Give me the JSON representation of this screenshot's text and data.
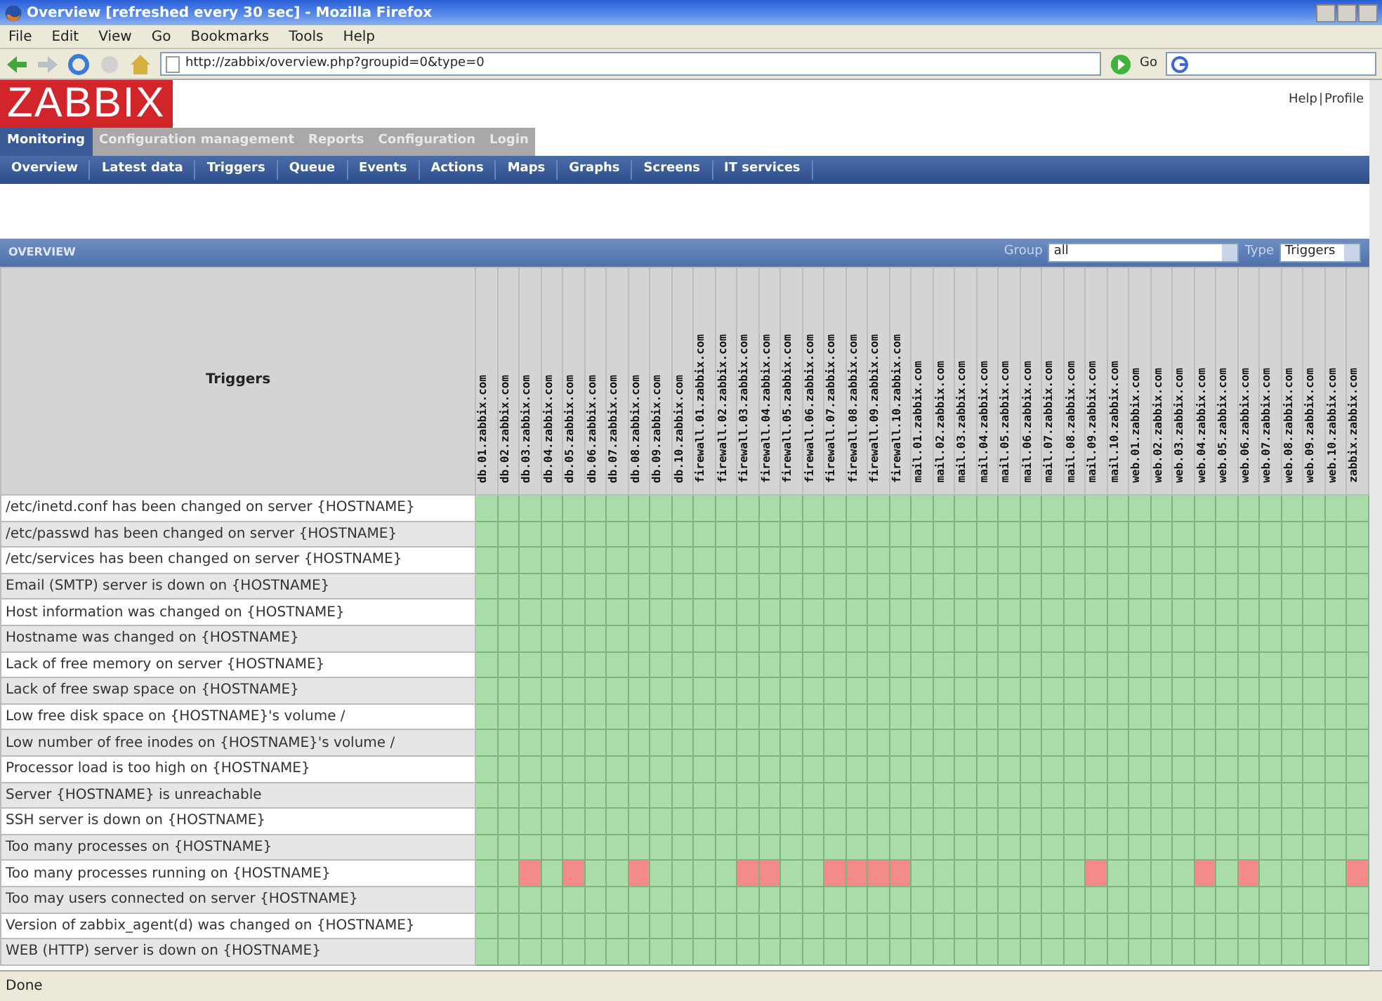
{
  "window": {
    "title": "Overview [refreshed every 30 sec] - Mozilla Firefox"
  },
  "browser_menu": [
    "File",
    "Edit",
    "View",
    "Go",
    "Bookmarks",
    "Tools",
    "Help"
  ],
  "address_bar": {
    "url": "http://zabbix/overview.php?groupid=0&type=0",
    "go_label": "Go"
  },
  "header": {
    "logo": "ZABBIX",
    "links": [
      "Help",
      "|",
      "Profile"
    ]
  },
  "main_menu": [
    {
      "label": "Monitoring",
      "selected": true
    },
    {
      "label": "Configuration management",
      "selected": false
    },
    {
      "label": "Reports",
      "selected": false
    },
    {
      "label": "Configuration",
      "selected": false
    },
    {
      "label": "Login",
      "selected": false
    }
  ],
  "sub_menu": [
    "Overview",
    "Latest data",
    "Triggers",
    "Queue",
    "Events",
    "Actions",
    "Maps",
    "Graphs",
    "Screens",
    "IT services"
  ],
  "overview": {
    "title": "OVERVIEW",
    "group_label": "Group",
    "group_value": "all",
    "type_label": "Type",
    "type_value": "Triggers"
  },
  "table": {
    "first_column": "Triggers",
    "hosts": [
      "db.01.zabbix.com",
      "db.02.zabbix.com",
      "db.03.zabbix.com",
      "db.04.zabbix.com",
      "db.05.zabbix.com",
      "db.06.zabbix.com",
      "db.07.zabbix.com",
      "db.08.zabbix.com",
      "db.09.zabbix.com",
      "db.10.zabbix.com",
      "firewall.01.zabbix.com",
      "firewall.02.zabbix.com",
      "firewall.03.zabbix.com",
      "firewall.04.zabbix.com",
      "firewall.05.zabbix.com",
      "firewall.06.zabbix.com",
      "firewall.07.zabbix.com",
      "firewall.08.zabbix.com",
      "firewall.09.zabbix.com",
      "firewall.10.zabbix.com",
      "mail.01.zabbix.com",
      "mail.02.zabbix.com",
      "mail.03.zabbix.com",
      "mail.04.zabbix.com",
      "mail.05.zabbix.com",
      "mail.06.zabbix.com",
      "mail.07.zabbix.com",
      "mail.08.zabbix.com",
      "mail.09.zabbix.com",
      "mail.10.zabbix.com",
      "web.01.zabbix.com",
      "web.02.zabbix.com",
      "web.03.zabbix.com",
      "web.04.zabbix.com",
      "web.05.zabbix.com",
      "web.06.zabbix.com",
      "web.07.zabbix.com",
      "web.08.zabbix.com",
      "web.09.zabbix.com",
      "web.10.zabbix.com",
      "zabbix.zabbix.com"
    ],
    "rows": [
      {
        "trigger": "/etc/inetd.conf has been changed on server {HOSTNAME}",
        "problem": [
          false,
          false,
          false,
          false,
          false,
          false,
          false,
          false,
          false,
          false,
          false,
          false,
          false,
          false,
          false,
          false,
          false,
          false,
          false,
          false,
          false,
          false,
          false,
          false,
          false,
          false,
          false,
          false,
          false,
          false,
          false,
          false,
          false,
          false,
          false,
          false,
          false,
          false,
          false,
          false,
          false
        ]
      },
      {
        "trigger": "/etc/passwd has been changed on server {HOSTNAME}",
        "problem": [
          false,
          false,
          false,
          false,
          false,
          false,
          false,
          false,
          false,
          false,
          false,
          false,
          false,
          false,
          false,
          false,
          false,
          false,
          false,
          false,
          false,
          false,
          false,
          false,
          false,
          false,
          false,
          false,
          false,
          false,
          false,
          false,
          false,
          false,
          false,
          false,
          false,
          false,
          false,
          false,
          false
        ]
      },
      {
        "trigger": "/etc/services has been changed on server {HOSTNAME}",
        "problem": [
          false,
          false,
          false,
          false,
          false,
          false,
          false,
          false,
          false,
          false,
          false,
          false,
          false,
          false,
          false,
          false,
          false,
          false,
          false,
          false,
          false,
          false,
          false,
          false,
          false,
          false,
          false,
          false,
          false,
          false,
          false,
          false,
          false,
          false,
          false,
          false,
          false,
          false,
          false,
          false,
          false
        ]
      },
      {
        "trigger": "Email (SMTP) server is down on {HOSTNAME}",
        "problem": [
          false,
          false,
          false,
          false,
          false,
          false,
          false,
          false,
          false,
          false,
          false,
          false,
          false,
          false,
          false,
          false,
          false,
          false,
          false,
          false,
          false,
          false,
          false,
          false,
          false,
          false,
          false,
          false,
          false,
          false,
          false,
          false,
          false,
          false,
          false,
          false,
          false,
          false,
          false,
          false,
          false
        ]
      },
      {
        "trigger": "Host information was changed on {HOSTNAME}",
        "problem": [
          false,
          false,
          false,
          false,
          false,
          false,
          false,
          false,
          false,
          false,
          false,
          false,
          false,
          false,
          false,
          false,
          false,
          false,
          false,
          false,
          false,
          false,
          false,
          false,
          false,
          false,
          false,
          false,
          false,
          false,
          false,
          false,
          false,
          false,
          false,
          false,
          false,
          false,
          false,
          false,
          false
        ]
      },
      {
        "trigger": "Hostname was changed on {HOSTNAME}",
        "problem": [
          false,
          false,
          false,
          false,
          false,
          false,
          false,
          false,
          false,
          false,
          false,
          false,
          false,
          false,
          false,
          false,
          false,
          false,
          false,
          false,
          false,
          false,
          false,
          false,
          false,
          false,
          false,
          false,
          false,
          false,
          false,
          false,
          false,
          false,
          false,
          false,
          false,
          false,
          false,
          false,
          false
        ]
      },
      {
        "trigger": "Lack of free memory on server {HOSTNAME}",
        "problem": [
          false,
          false,
          false,
          false,
          false,
          false,
          false,
          false,
          false,
          false,
          false,
          false,
          false,
          false,
          false,
          false,
          false,
          false,
          false,
          false,
          false,
          false,
          false,
          false,
          false,
          false,
          false,
          false,
          false,
          false,
          false,
          false,
          false,
          false,
          false,
          false,
          false,
          false,
          false,
          false,
          false
        ]
      },
      {
        "trigger": "Lack of free swap space on {HOSTNAME}",
        "problem": [
          false,
          false,
          false,
          false,
          false,
          false,
          false,
          false,
          false,
          false,
          false,
          false,
          false,
          false,
          false,
          false,
          false,
          false,
          false,
          false,
          false,
          false,
          false,
          false,
          false,
          false,
          false,
          false,
          false,
          false,
          false,
          false,
          false,
          false,
          false,
          false,
          false,
          false,
          false,
          false,
          false
        ]
      },
      {
        "trigger": "Low free disk space on {HOSTNAME}'s volume /",
        "problem": [
          false,
          false,
          false,
          false,
          false,
          false,
          false,
          false,
          false,
          false,
          false,
          false,
          false,
          false,
          false,
          false,
          false,
          false,
          false,
          false,
          false,
          false,
          false,
          false,
          false,
          false,
          false,
          false,
          false,
          false,
          false,
          false,
          false,
          false,
          false,
          false,
          false,
          false,
          false,
          false,
          false
        ]
      },
      {
        "trigger": "Low number of free inodes on {HOSTNAME}'s volume /",
        "problem": [
          false,
          false,
          false,
          false,
          false,
          false,
          false,
          false,
          false,
          false,
          false,
          false,
          false,
          false,
          false,
          false,
          false,
          false,
          false,
          false,
          false,
          false,
          false,
          false,
          false,
          false,
          false,
          false,
          false,
          false,
          false,
          false,
          false,
          false,
          false,
          false,
          false,
          false,
          false,
          false,
          false
        ]
      },
      {
        "trigger": "Processor load is too high on {HOSTNAME}",
        "problem": [
          false,
          false,
          false,
          false,
          false,
          false,
          false,
          false,
          false,
          false,
          false,
          false,
          false,
          false,
          false,
          false,
          false,
          false,
          false,
          false,
          false,
          false,
          false,
          false,
          false,
          false,
          false,
          false,
          false,
          false,
          false,
          false,
          false,
          false,
          false,
          false,
          false,
          false,
          false,
          false,
          false
        ]
      },
      {
        "trigger": "Server {HOSTNAME} is unreachable",
        "problem": [
          false,
          false,
          false,
          false,
          false,
          false,
          false,
          false,
          false,
          false,
          false,
          false,
          false,
          false,
          false,
          false,
          false,
          false,
          false,
          false,
          false,
          false,
          false,
          false,
          false,
          false,
          false,
          false,
          false,
          false,
          false,
          false,
          false,
          false,
          false,
          false,
          false,
          false,
          false,
          false,
          false
        ]
      },
      {
        "trigger": "SSH server is down on {HOSTNAME}",
        "problem": [
          false,
          false,
          false,
          false,
          false,
          false,
          false,
          false,
          false,
          false,
          false,
          false,
          false,
          false,
          false,
          false,
          false,
          false,
          false,
          false,
          false,
          false,
          false,
          false,
          false,
          false,
          false,
          false,
          false,
          false,
          false,
          false,
          false,
          false,
          false,
          false,
          false,
          false,
          false,
          false,
          false
        ]
      },
      {
        "trigger": "Too many processes on {HOSTNAME}",
        "problem": [
          false,
          false,
          false,
          false,
          false,
          false,
          false,
          false,
          false,
          false,
          false,
          false,
          false,
          false,
          false,
          false,
          false,
          false,
          false,
          false,
          false,
          false,
          false,
          false,
          false,
          false,
          false,
          false,
          false,
          false,
          false,
          false,
          false,
          false,
          false,
          false,
          false,
          false,
          false,
          false,
          false
        ]
      },
      {
        "trigger": "Too many processes running on {HOSTNAME}",
        "problem": [
          false,
          false,
          true,
          false,
          true,
          false,
          false,
          true,
          false,
          false,
          false,
          false,
          true,
          true,
          false,
          false,
          true,
          true,
          true,
          true,
          false,
          false,
          false,
          false,
          false,
          false,
          false,
          false,
          true,
          false,
          false,
          false,
          false,
          true,
          false,
          true,
          false,
          false,
          false,
          false,
          true
        ]
      },
      {
        "trigger": "Too may users connected on server {HOSTNAME}",
        "problem": [
          false,
          false,
          false,
          false,
          false,
          false,
          false,
          false,
          false,
          false,
          false,
          false,
          false,
          false,
          false,
          false,
          false,
          false,
          false,
          false,
          false,
          false,
          false,
          false,
          false,
          false,
          false,
          false,
          false,
          false,
          false,
          false,
          false,
          false,
          false,
          false,
          false,
          false,
          false,
          false,
          false
        ]
      },
      {
        "trigger": "Version of zabbix_agent(d) was changed on {HOSTNAME}",
        "problem": [
          false,
          false,
          false,
          false,
          false,
          false,
          false,
          false,
          false,
          false,
          false,
          false,
          false,
          false,
          false,
          false,
          false,
          false,
          false,
          false,
          false,
          false,
          false,
          false,
          false,
          false,
          false,
          false,
          false,
          false,
          false,
          false,
          false,
          false,
          false,
          false,
          false,
          false,
          false,
          false,
          false
        ]
      },
      {
        "trigger": "WEB (HTTP) server is down on {HOSTNAME}",
        "problem": [
          false,
          false,
          false,
          false,
          false,
          false,
          false,
          false,
          false,
          false,
          false,
          false,
          false,
          false,
          false,
          false,
          false,
          false,
          false,
          false,
          false,
          false,
          false,
          false,
          false,
          false,
          false,
          false,
          false,
          false,
          false,
          false,
          false,
          false,
          false,
          false,
          false,
          false,
          false,
          false,
          false
        ]
      }
    ]
  },
  "status_bar": "Done"
}
